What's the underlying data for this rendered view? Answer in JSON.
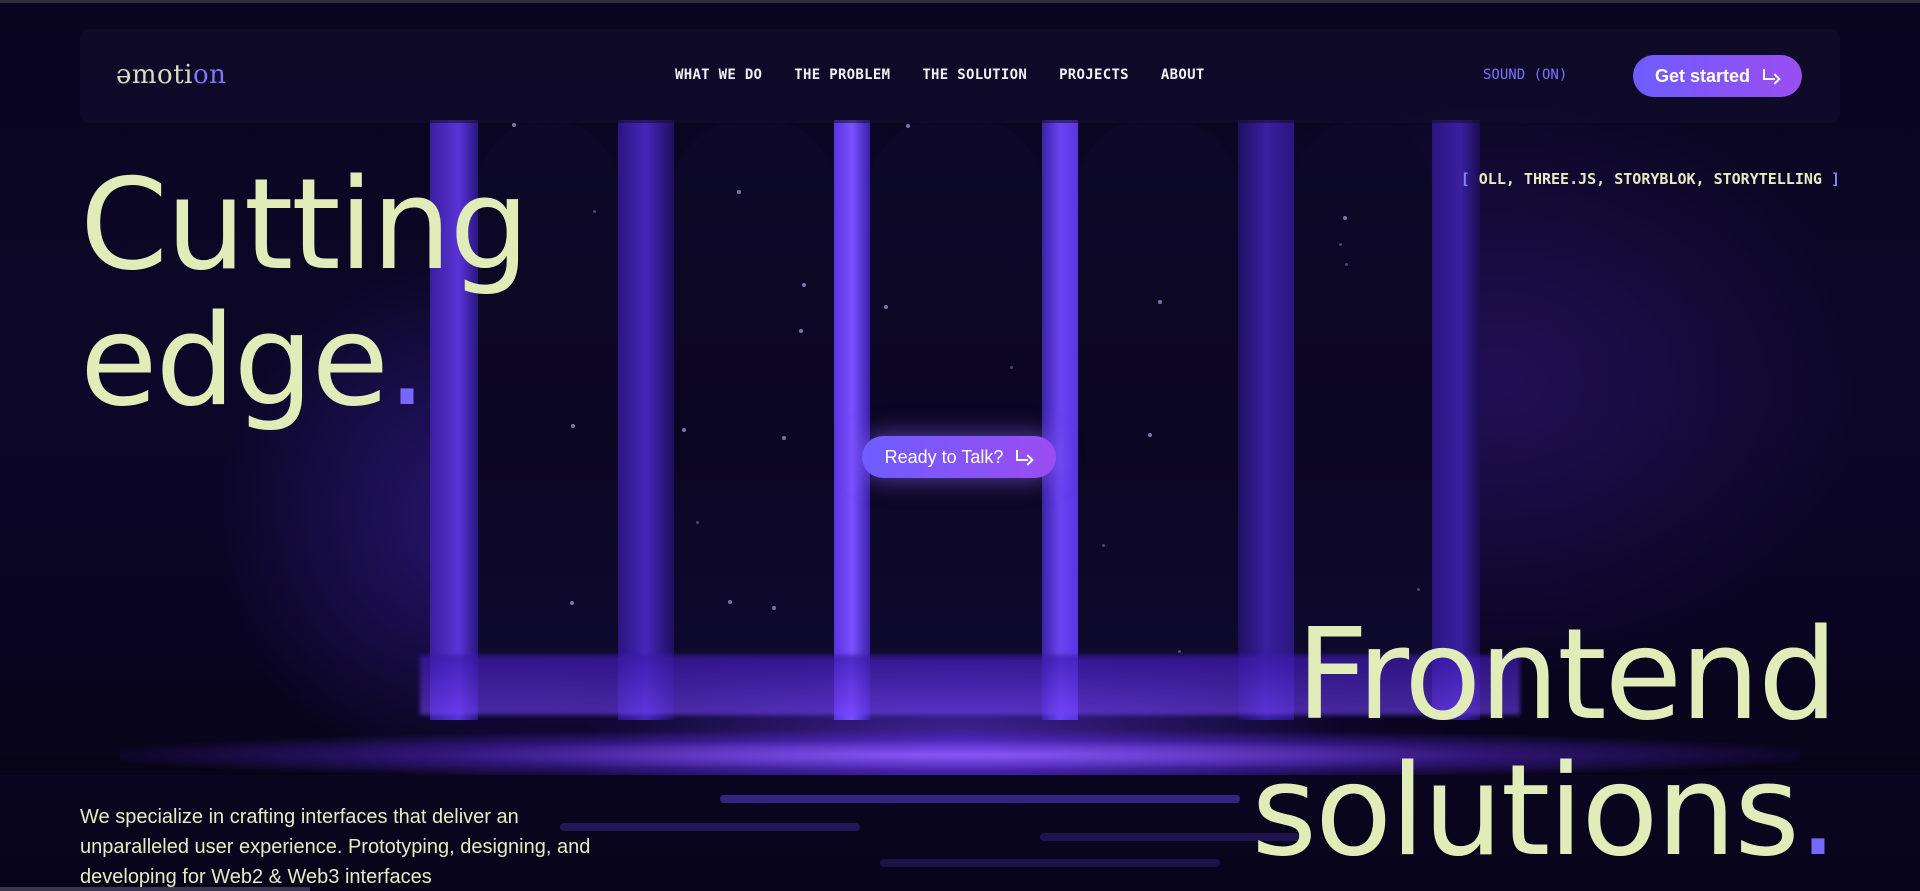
{
  "logo": {
    "text_main": "əmoti",
    "text_accent": "on"
  },
  "nav": {
    "items": [
      {
        "label": "WHAT WE DO"
      },
      {
        "label": "THE PROBLEM"
      },
      {
        "label": "THE SOLUTION"
      },
      {
        "label": "PROJECTS"
      },
      {
        "label": "ABOUT"
      }
    ]
  },
  "header": {
    "sound_label": "SOUND (ON)",
    "cta_label": "Get started"
  },
  "hero": {
    "line1": "Cutting",
    "line2": "edge",
    "line3": "Frontend",
    "line4": "solutions",
    "period": ".",
    "tags_open": "[",
    "tags_text": "OLL, THREE.JS, STORYBLOK, STORYTELLING",
    "tags_close": "]",
    "center_cta_label": "Ready to Talk?",
    "intro": "We specialize in crafting interfaces that deliver an unparalleled user experience. Prototyping, designing, and developing for Web2 & Web3 interfaces"
  },
  "colors": {
    "accent": "#7768ff",
    "button_gradient_start": "#6e5dff",
    "button_gradient_end": "#9b4df0",
    "headline": "#e2ecb8",
    "background": "#07041a"
  },
  "icons": {
    "cta_arrow": "arrow-turn-down-right-icon"
  }
}
